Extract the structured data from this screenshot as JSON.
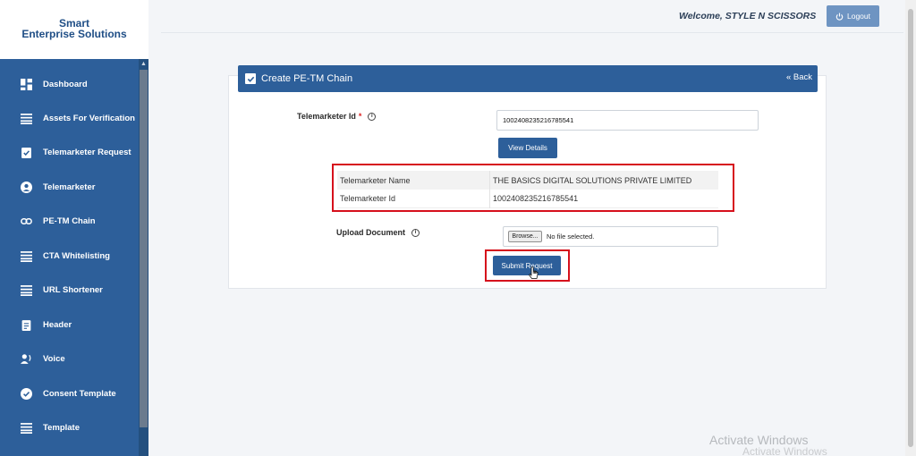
{
  "brand": {
    "line1": "Smart",
    "line2": "Enterprise Solutions"
  },
  "sidebar": {
    "items": [
      {
        "label": "Dashboard",
        "icon": "dashboard-icon"
      },
      {
        "label": "Assets For Verification",
        "icon": "list-icon"
      },
      {
        "label": "Telemarketer Request",
        "icon": "clipboard-check-icon"
      },
      {
        "label": "Telemarketer",
        "icon": "user-circle-icon"
      },
      {
        "label": "PE-TM Chain",
        "icon": "link-icon"
      },
      {
        "label": "CTA Whitelisting",
        "icon": "list-icon"
      },
      {
        "label": "URL Shortener",
        "icon": "list-icon"
      },
      {
        "label": "Header",
        "icon": "clipboard-icon"
      },
      {
        "label": "Voice",
        "icon": "voice-icon"
      },
      {
        "label": "Consent Template",
        "icon": "check-circle-icon"
      },
      {
        "label": "Template",
        "icon": "list-icon"
      }
    ]
  },
  "header": {
    "welcome_prefix": "Welcome, ",
    "user_name": "STYLE N SCISSORS",
    "logout_label": "Logout"
  },
  "card": {
    "title": "Create PE-TM Chain",
    "back_label": "« Back",
    "telemarketer_id_label": "Telemarketer Id",
    "telemarketer_id_value": "1002408235216785541",
    "view_details_label": "View Details",
    "details": [
      {
        "key": "Telemarketer Name",
        "value": "THE BASICS DIGITAL SOLUTIONS PRIVATE LIMITED"
      },
      {
        "key": "Telemarketer Id",
        "value": "1002408235216785541"
      }
    ],
    "upload_label": "Upload Document",
    "browse_label": "Browse...",
    "no_file_label": "No file selected.",
    "submit_label": "Submit Request"
  },
  "watermark": {
    "line1": "Activate Windows",
    "line2": "Activate Windows"
  },
  "colors": {
    "primary": "#2d5f9a",
    "highlight": "#d6101c"
  }
}
